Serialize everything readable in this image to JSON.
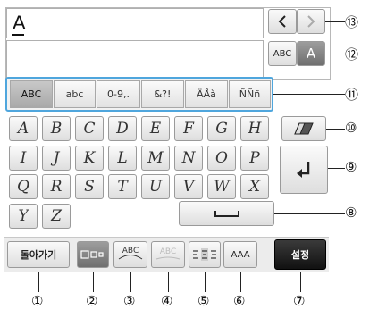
{
  "text_input": {
    "value": "A"
  },
  "nav": {
    "prev_icon": "chevron-left-icon",
    "next_icon": "chevron-right-icon"
  },
  "case_toggle": {
    "lower_label": "ABC",
    "upper_label": "A"
  },
  "category_tabs": [
    {
      "label": "ABC"
    },
    {
      "label": "abc"
    },
    {
      "label": "0-9,."
    },
    {
      "label": "&?!"
    },
    {
      "label": "ÄÅà"
    },
    {
      "label": "ÑÑñ"
    }
  ],
  "keys": {
    "row1": [
      "A",
      "B",
      "C",
      "D",
      "E",
      "F",
      "G",
      "H"
    ],
    "row2": [
      "I",
      "J",
      "K",
      "L",
      "M",
      "N",
      "O",
      "P"
    ],
    "row3": [
      "Q",
      "R",
      "S",
      "T",
      "U",
      "V",
      "W",
      "X"
    ],
    "row4": [
      "Y",
      "Z"
    ]
  },
  "special_keys": {
    "delete_icon": "eraser-icon",
    "enter_icon": "enter-arrow-icon",
    "space_icon": "space-bar-icon"
  },
  "bottom_bar": {
    "back_label": "돌아가기",
    "size_icon": "font-size-icon",
    "arc_label": "ABC",
    "arc2_label": "ABC",
    "align_icon": "align-icon",
    "font_label": "AAA",
    "set_label": "설정"
  },
  "callouts": [
    "①",
    "②",
    "③",
    "④",
    "⑤",
    "⑥",
    "⑦",
    "⑧",
    "⑨",
    "⑩",
    "⑪",
    "⑫",
    "⑬"
  ]
}
